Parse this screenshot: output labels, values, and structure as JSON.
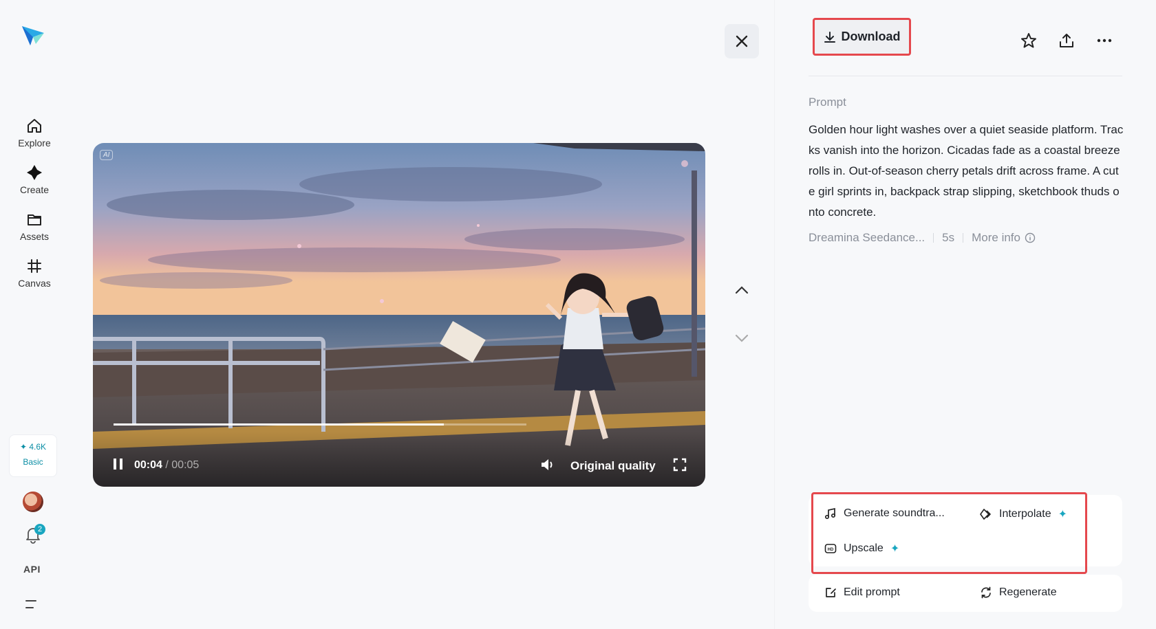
{
  "sidebar": {
    "items": [
      {
        "label": "Explore",
        "icon": "home-icon"
      },
      {
        "label": "Create",
        "icon": "sparkle-icon"
      },
      {
        "label": "Assets",
        "icon": "folder-icon"
      },
      {
        "label": "Canvas",
        "icon": "canvas-icon"
      }
    ],
    "credits": {
      "amount": "✦ 4.6K",
      "plan": "Basic"
    },
    "notifications_count": "2",
    "api_label": "API"
  },
  "video": {
    "ai_tag": "AI",
    "current_time": "00:04",
    "separator": " / ",
    "duration": "00:05",
    "progress": 0.8,
    "quality": "Original quality"
  },
  "panel": {
    "download_label": "Download",
    "prompt_title": "Prompt",
    "prompt_text": "Golden hour light washes over a quiet seaside platform. Tracks vanish into the horizon. Cicadas fade as a coastal breeze rolls in. Out-of-season cherry petals drift across frame. A cute girl sprints in, backpack strap slipping, sketchbook thuds onto concrete.",
    "model": "Dreamina Seedance...",
    "length": "5s",
    "more_info": "More info"
  },
  "actions": {
    "generate_soundtrack": "Generate soundtra...",
    "interpolate": "Interpolate",
    "upscale": "Upscale",
    "edit_prompt": "Edit prompt",
    "regenerate": "Regenerate"
  },
  "colors": {
    "accent": "#19a6c0",
    "highlight": "#e5484d"
  }
}
